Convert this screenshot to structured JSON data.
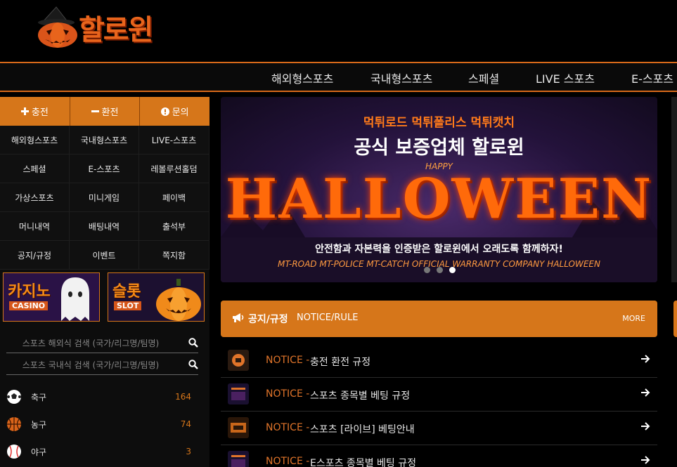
{
  "logo": {
    "text": "할로윈"
  },
  "topnav": [
    "해외형스포츠",
    "국내형스포츠",
    "스페셜",
    "LIVE 스포츠",
    "E-스포츠"
  ],
  "actions": [
    {
      "label": "충전",
      "icon": "plus-icon"
    },
    {
      "label": "환전",
      "icon": "minus-icon"
    },
    {
      "label": "문의",
      "icon": "info-icon"
    }
  ],
  "menu": [
    "해외형스포츠",
    "국내형스포츠",
    "LIVE-스포츠",
    "스페셜",
    "E-스포츠",
    "레볼루션홀덤",
    "가상스포츠",
    "미니게임",
    "페이백",
    "머니내역",
    "배팅내역",
    "출석부",
    "공지/규정",
    "이벤트",
    "쪽지함"
  ],
  "banners": [
    {
      "title": "카지노",
      "sub": "CASINO"
    },
    {
      "title": "슬롯",
      "sub": "SLOT"
    }
  ],
  "search": {
    "overseas_placeholder": "스포츠 해외식 검색 (국가/리그명/팀명)",
    "domestic_placeholder": "스포츠 국내식 검색 (국가/리그명/팀명)"
  },
  "sports": [
    {
      "name": "축구",
      "count": "164",
      "icon": "soccer-ball-icon"
    },
    {
      "name": "농구",
      "count": "74",
      "icon": "basketball-icon"
    },
    {
      "name": "야구",
      "count": "3",
      "icon": "baseball-icon"
    }
  ],
  "hero": {
    "line1": "먹튀로드 먹튀폴리스 먹튀캣치",
    "line2": "공식 보증업체 할로윈",
    "happy": "HAPPY",
    "big": "HALLOWEEN",
    "line3": "안전함과 자본력을 인증받은 할로윈에서 오래도록 함께하자!",
    "line4": "MT-ROAD MT-POLICE MT-CATCH OFFICIAL WARRANTY COMPANY HALLOWEEN",
    "active_slide": 3,
    "slide_count": 3
  },
  "notice": {
    "title": "공지/규정",
    "subtitle": "NOTICE/RULE",
    "more": "MORE",
    "items": [
      {
        "tag": "NOTICE -",
        "text": "충전 환전 규정"
      },
      {
        "tag": "NOTICE -",
        "text": "스포츠 종목별 베팅 규정"
      },
      {
        "tag": "NOTICE -",
        "text": "스포츠 [라이브] 베팅안내"
      },
      {
        "tag": "NOTICE -",
        "text": "E스포츠 종목별 베팅 규정"
      }
    ]
  },
  "colors": {
    "accent": "#d6761a",
    "background": "#000000",
    "panel": "#101010"
  }
}
